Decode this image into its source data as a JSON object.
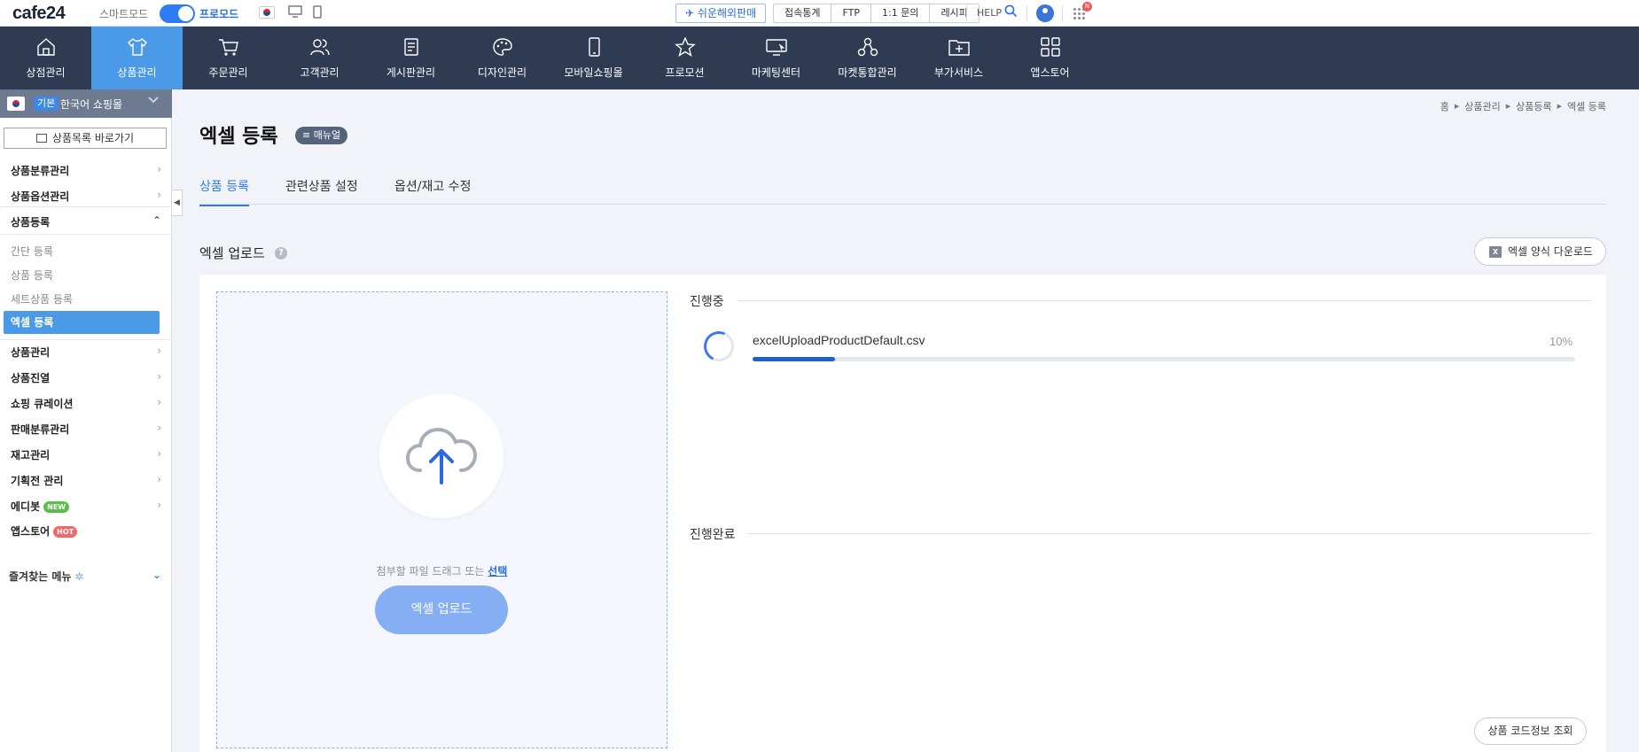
{
  "topbar": {
    "logo": "cafe24",
    "mode_off": "스마트모드",
    "mode_on": "프로모드",
    "global_btn": "쉬운해외판매",
    "links": [
      "접속통계",
      "FTP",
      "1:1 문의",
      "레시피"
    ],
    "help": "HELP",
    "apps_badge": "N"
  },
  "mainnav": [
    {
      "label": "상점관리",
      "icon": "home-icon"
    },
    {
      "label": "상품관리",
      "icon": "shirt-icon",
      "active": true
    },
    {
      "label": "주문관리",
      "icon": "cart-icon"
    },
    {
      "label": "고객관리",
      "icon": "users-icon"
    },
    {
      "label": "게시판관리",
      "icon": "board-icon"
    },
    {
      "label": "디자인관리",
      "icon": "palette-icon"
    },
    {
      "label": "모바일쇼핑몰",
      "icon": "mobile-icon"
    },
    {
      "label": "프로모션",
      "icon": "star-icon"
    },
    {
      "label": "마케팅센터",
      "icon": "monitor-icon"
    },
    {
      "label": "마켓통합관리",
      "icon": "nodes-icon"
    },
    {
      "label": "부가서비스",
      "icon": "folder-plus-icon"
    },
    {
      "label": "앱스토어",
      "icon": "grid-icon"
    }
  ],
  "sidebar": {
    "mall_badge": "기본",
    "mall_name": "한국어 쇼핑몰",
    "shortcut": "상품목록 바로가기",
    "items_top": [
      "상품분류관리",
      "상품옵션관리"
    ],
    "open_item": "상품등록",
    "subitems": [
      "간단 등록",
      "상품 등록",
      "세트상품 등록"
    ],
    "active_sub": "엑셀 등록",
    "items_bottom": [
      "상품관리",
      "상품진열",
      "쇼핑 큐레이션",
      "판매분류관리",
      "재고관리",
      "기획전 관리",
      "에디봇",
      "앱스토어"
    ],
    "badge_new": "NEW",
    "badge_hot": "HOT",
    "favorites": "즐겨찾는 메뉴"
  },
  "breadcrumb": [
    "홈",
    "상품관리",
    "상품등록",
    "엑셀 등록"
  ],
  "page": {
    "title": "엑셀 등록",
    "manual": "≡ 매뉴얼",
    "tabs": [
      "상품 등록",
      "관련상품 설정",
      "옵션/재고 수정"
    ],
    "section_title": "엑셀 업로드",
    "download_btn": "엑셀 양식 다운로드",
    "drop_text": "첨부할 파일 드래그 또는",
    "drop_link": "선택",
    "upload_btn": "엑셀 업로드",
    "in_progress_label": "진행중",
    "done_label": "진행완료",
    "file_name": "excelUploadProductDefault.csv",
    "progress_pct": "10%",
    "progress_value": 0.1,
    "code_btn": "상품 코드정보 조회"
  },
  "colors": {
    "nav_bg": "#2f3b52",
    "nav_active": "#4b9ae8",
    "accent": "#2b7cf0",
    "progress": "#1e5fd8"
  }
}
